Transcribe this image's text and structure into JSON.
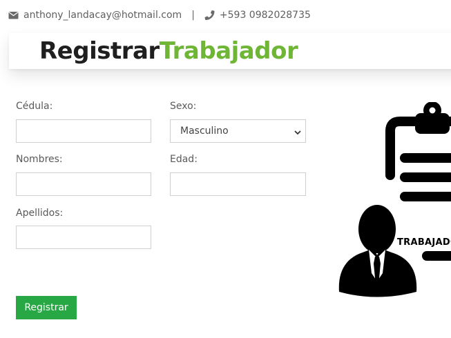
{
  "contact": {
    "email": "anthony_landacay@hotmail.com",
    "separator": "|",
    "phone": "+593 0982028735"
  },
  "page": {
    "title_part1": "Registrar",
    "title_part2": "Trabajador"
  },
  "form": {
    "cedula_label": "Cédula:",
    "sexo_label": "Sexo:",
    "sexo_value": "Masculino",
    "nombres_label": "Nombres:",
    "edad_label": "Edad:",
    "apellidos_label": "Apellidos:",
    "submit_label": "Registrar"
  },
  "illustration": {
    "caption": "TRABAJADOR"
  },
  "colors": {
    "accent_green": "#6fb536",
    "button_green": "#28a745"
  },
  "icons": [
    "envelope-icon",
    "phone-icon",
    "chevron-down-icon",
    "clipboard-icon",
    "worker-icon"
  ]
}
